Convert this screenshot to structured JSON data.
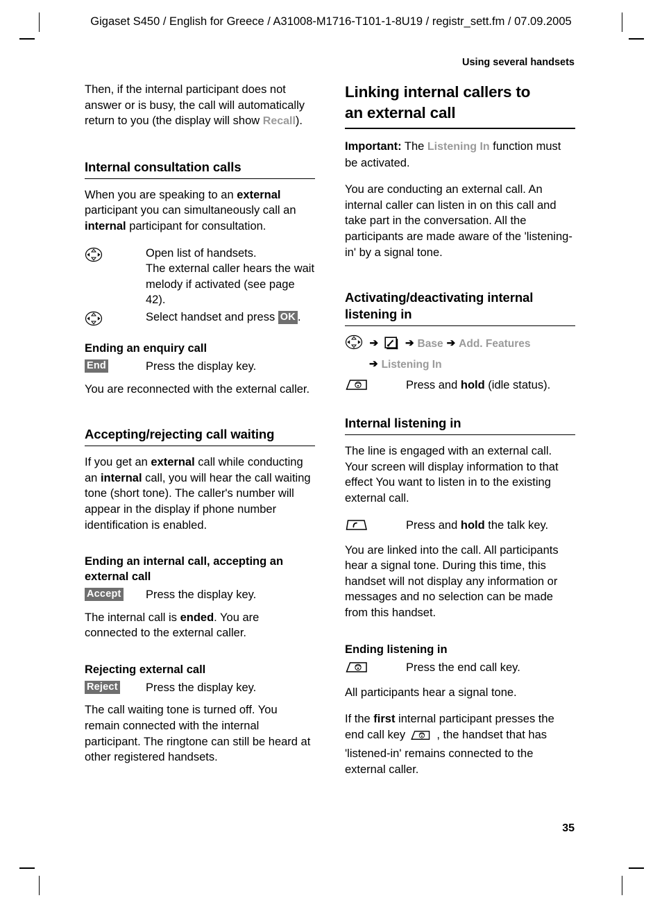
{
  "header": {
    "running_head": "Gigaset S450 / English for Greece / A31008-M1716-T101-1-8U19 / registr_sett.fm / 07.09.2005",
    "section_label": "Using several handsets",
    "page_number": "35"
  },
  "left_column": {
    "intro": {
      "part1": "Then, if the internal participant does not answer or is busy, the call will automatically return to you (the display will show ",
      "display_word": "Recall",
      "part2": ")."
    },
    "internal_consultation": {
      "heading": "Internal consultation calls",
      "body_1": "When you are speaking to an ",
      "body_bold_1": "external",
      "body_2": " participant you can simultaneously call an ",
      "body_bold_2": "internal",
      "body_3": " participant for consultation.",
      "step_1": {
        "icon": "navigation-key-icon",
        "line_1": "Open list of handsets.",
        "line_2": "The external caller hears the wait melody if activated (see page 42)."
      },
      "step_2": {
        "icon": "navigation-key-icon",
        "text_before": "Select handset and press ",
        "softkey": "OK",
        "text_after": "."
      }
    },
    "ending_enquiry": {
      "heading": "Ending an enquiry call",
      "softkey": "End",
      "step_text": "Press the display key.",
      "body": "You are reconnected with the external caller."
    },
    "call_waiting": {
      "heading": "Accepting/rejecting call waiting",
      "body_1": "If you get an ",
      "body_bold_1": "external",
      "body_2": " call while conducting an ",
      "body_bold_2": "internal",
      "body_3": " call, you will hear the call waiting tone (short tone). The caller's number will appear in the display if phone number identification is enabled."
    },
    "ending_internal": {
      "heading": "Ending an internal call, accepting an external call",
      "softkey": "Accept",
      "step_text": "Press the display key.",
      "body_1": "The internal call is ",
      "body_bold_1": "ended",
      "body_2": ". You are connected to the external caller."
    },
    "rejecting_external": {
      "heading": "Rejecting external call",
      "softkey": "Reject",
      "step_text": "Press the display key.",
      "body": "The call waiting tone is turned off. You remain connected with the internal participant. The ringtone can still be heard at other registered handsets."
    }
  },
  "right_column": {
    "chapter_heading_line1": "Linking internal callers to",
    "chapter_heading_line2": "an external call",
    "important": {
      "label": "Important:",
      "text_before": " The ",
      "menu_word": "Listening In",
      "text_after": " function must be activated."
    },
    "intro_body": "You are conducting an external call. An internal caller can listen in on this call and take part in the conversation. All the participants are made aware of the 'listening-in' by a signal tone.",
    "activating": {
      "heading_line1": "Activating/deactivating internal",
      "heading_line2": "listening in",
      "menu_path": {
        "nav_icon": "navigation-key-icon",
        "arrow": "➔",
        "settings_icon": "settings-tool-icon",
        "item_1": "Base",
        "item_2": "Add. Features",
        "item_3": "Listening In"
      },
      "step": {
        "icon": "end-call-key-icon",
        "text_before": "Press and ",
        "text_bold": "hold",
        "text_after": " (idle status)."
      }
    },
    "internal_listening": {
      "heading": "Internal listening in",
      "body": "The line is engaged with an external call. Your screen will display information to that effect You want to listen in to the existing external call.",
      "step": {
        "icon": "talk-key-icon",
        "text_before": "Press and ",
        "text_bold": "hold",
        "text_after": " the talk key."
      },
      "after_body": "You are linked into the call. All participants hear a signal tone. During this time, this handset will not display any information or messages and no selection can be made from this handset."
    },
    "ending_listening": {
      "heading": "Ending listening in",
      "step": {
        "icon": "end-call-key-icon",
        "text": "Press the end call key."
      },
      "body_1": "All participants hear a signal tone.",
      "body_2_before": "If the ",
      "body_2_bold": "first",
      "body_2_mid": " internal participant presses the end call key ",
      "body_2_after": ", the handset that has 'listened-in' remains connected to the external caller."
    }
  }
}
